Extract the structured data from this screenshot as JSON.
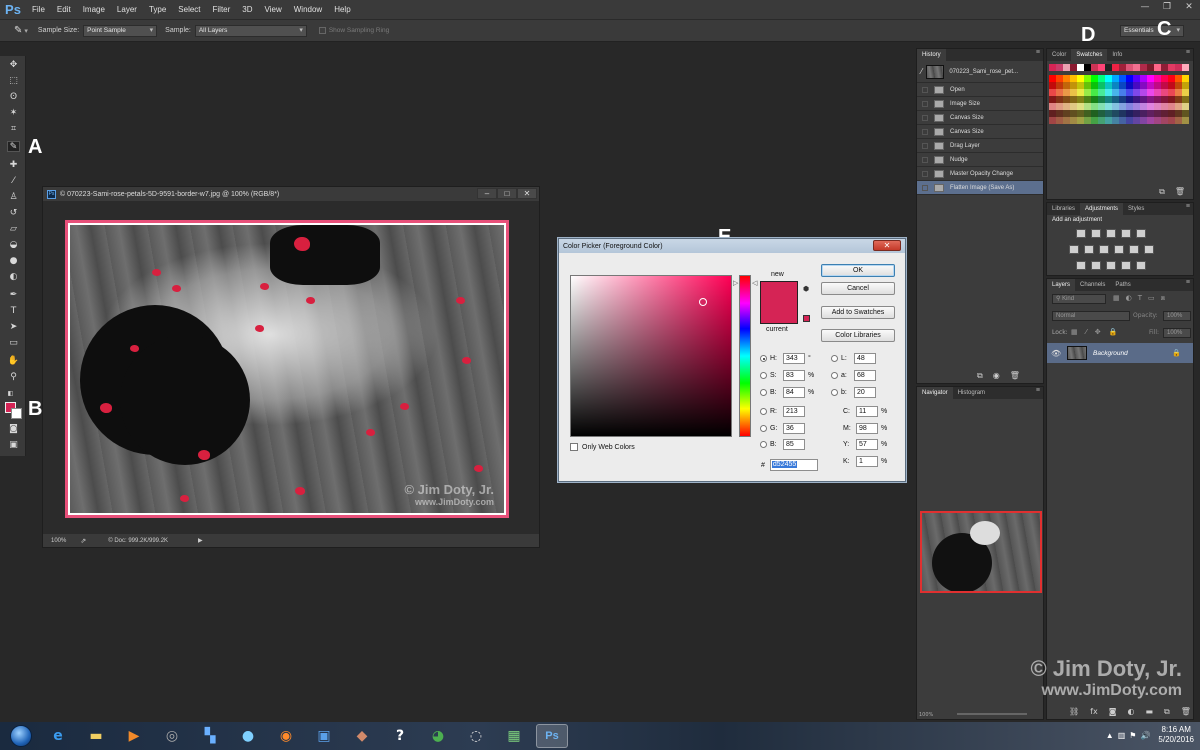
{
  "app": {
    "logo": "Ps",
    "menu": [
      "File",
      "Edit",
      "Image",
      "Layer",
      "Type",
      "Select",
      "Filter",
      "3D",
      "View",
      "Window",
      "Help"
    ]
  },
  "options_bar": {
    "sample_size_label": "Sample Size:",
    "sample_size_value": "Point Sample",
    "sample_label": "Sample:",
    "sample_value": "All Layers",
    "show_ring_label": "Show Sampling Ring",
    "workspace": "Essentials"
  },
  "callouts": {
    "a": "A",
    "b": "B",
    "c": "C",
    "d": "D",
    "e": "E"
  },
  "document": {
    "title": "© 070223-Sami-rose-petals-5D-9591-border-w7.jpg @ 100% (RGB/8*)",
    "zoom": "100%",
    "doc_size": "© Doc: 999.2K/999.2K",
    "watermark_line1": "© Jim Doty, Jr.",
    "watermark_line2": "www.JimDoty.com"
  },
  "color_picker": {
    "title": "Color Picker (Foreground Color)",
    "ok": "OK",
    "cancel": "Cancel",
    "add_to_swatches": "Add to Swatches",
    "color_libraries": "Color Libraries",
    "new_label": "new",
    "current_label": "current",
    "only_web_colors": "Only Web Colors",
    "fields_left": [
      {
        "label": "H:",
        "value": "343",
        "unit": "°"
      },
      {
        "label": "S:",
        "value": "83",
        "unit": "%"
      },
      {
        "label": "B:",
        "value": "84",
        "unit": "%"
      },
      {
        "label": "R:",
        "value": "213",
        "unit": ""
      },
      {
        "label": "G:",
        "value": "36",
        "unit": ""
      },
      {
        "label": "B:",
        "value": "85",
        "unit": ""
      }
    ],
    "fields_mid": [
      {
        "label": "L:",
        "value": "48"
      },
      {
        "label": "a:",
        "value": "68"
      },
      {
        "label": "b:",
        "value": "20"
      }
    ],
    "fields_cmyk": [
      {
        "label": "C:",
        "value": "11",
        "unit": "%"
      },
      {
        "label": "M:",
        "value": "98",
        "unit": "%"
      },
      {
        "label": "Y:",
        "value": "57",
        "unit": "%"
      },
      {
        "label": "K:",
        "value": "1",
        "unit": "%"
      }
    ],
    "hex_prefix": "#",
    "hex": "d52455",
    "color_hex": "#d52455"
  },
  "history": {
    "tab": "History",
    "snapshot": "070223_Sami_rose_pet...",
    "items": [
      "Open",
      "Image Size",
      "Canvas Size",
      "Canvas Size",
      "Drag Layer",
      "Nudge",
      "Master Opacity Change",
      "Flatten Image (Save As)"
    ]
  },
  "navigator": {
    "tabs": [
      "Navigator",
      "Histogram"
    ],
    "zoom": "100%"
  },
  "swatches": {
    "tabs": [
      "Color",
      "Swatches",
      "Info"
    ]
  },
  "adjustments": {
    "tabs": [
      "Libraries",
      "Adjustments",
      "Styles"
    ],
    "heading": "Add an adjustment"
  },
  "layers": {
    "tabs": [
      "Layers",
      "Channels",
      "Paths"
    ],
    "kind": "Kind",
    "blend": "Normal",
    "opacity_label": "Opacity:",
    "opacity_value": "100%",
    "lock_label": "Lock:",
    "fill_label": "Fill:",
    "fill_value": "100%",
    "layer_name": "Background"
  },
  "watermark": {
    "line1": "© Jim Doty, Jr.",
    "line2": "www.JimDoty.com"
  },
  "taskbar": {
    "time": "8:16 AM",
    "date": "5/20/2016"
  }
}
